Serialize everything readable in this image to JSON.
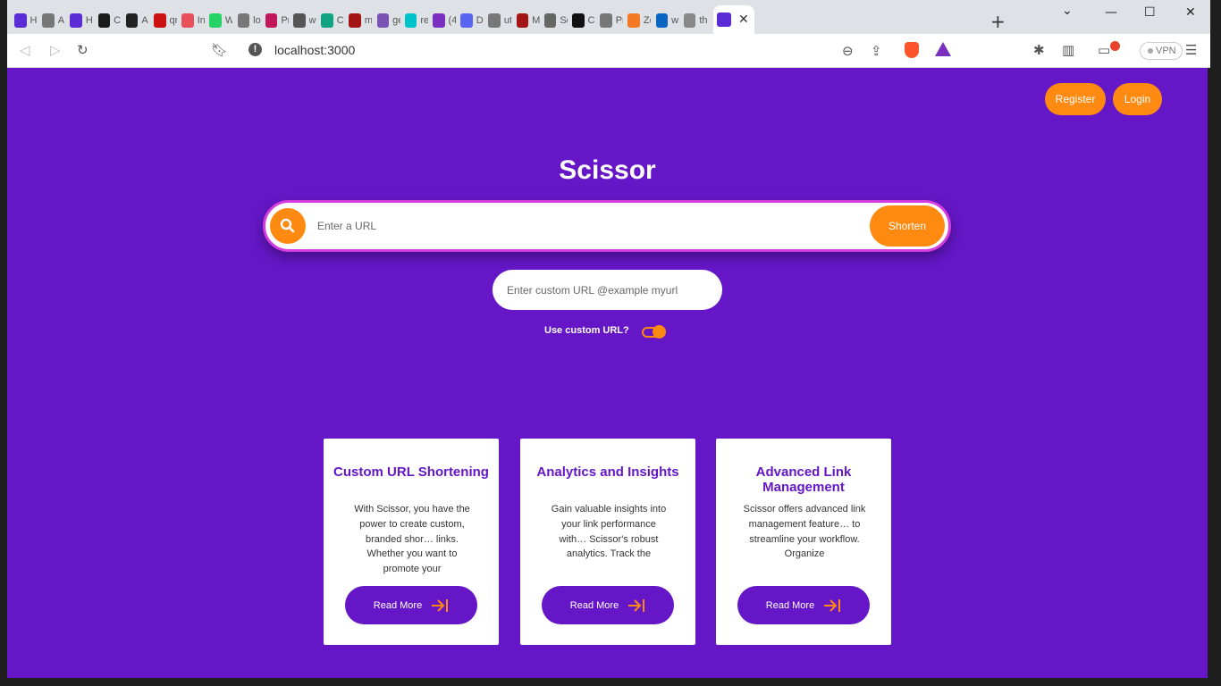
{
  "browser": {
    "tabs": [
      {
        "title": "H",
        "color": "#5b2bd6"
      },
      {
        "title": "A",
        "color": "#777777"
      },
      {
        "title": "H",
        "color": "#5b2bd6"
      },
      {
        "title": "C",
        "color": "#1a1a1a"
      },
      {
        "title": "A",
        "color": "#222222"
      },
      {
        "title": "qr",
        "color": "#cc1111"
      },
      {
        "title": "In",
        "color": "#e8505b"
      },
      {
        "title": "W",
        "color": "#25d366"
      },
      {
        "title": "lo",
        "color": "#777777"
      },
      {
        "title": "Pr",
        "color": "#c2185b"
      },
      {
        "title": "w",
        "color": "#555555"
      },
      {
        "title": "C",
        "color": "#10a37f"
      },
      {
        "title": "m",
        "color": "#a31515"
      },
      {
        "title": "ge",
        "color": "#7952b3"
      },
      {
        "title": "re",
        "color": "#00c2cb"
      },
      {
        "title": "(4",
        "color": "#7b2fbf"
      },
      {
        "title": "D",
        "color": "#5865f2"
      },
      {
        "title": "ut",
        "color": "#777777"
      },
      {
        "title": "M",
        "color": "#a31515"
      },
      {
        "title": "Se",
        "color": "#666666"
      },
      {
        "title": "C",
        "color": "#111111"
      },
      {
        "title": "Pr",
        "color": "#777777"
      },
      {
        "title": "Ze",
        "color": "#f37a22"
      },
      {
        "title": "w",
        "color": "#0a66c2"
      },
      {
        "title": "th",
        "color": "#888888"
      }
    ],
    "active_tab_color": "#5b2bd6",
    "close_glyph": "✕",
    "new_tab_glyph": "+",
    "url": "localhost:3000",
    "vpn_label": "VPN",
    "info_glyph": "!"
  },
  "app": {
    "title": "Scissor",
    "register_label": "Register",
    "login_label": "Login",
    "url_placeholder": "Enter a URL",
    "shorten_label": "Shorten",
    "custom_placeholder": "Enter custom URL @example myurl",
    "custom_toggle_label": "Use custom URL?",
    "custom_toggle_on": true,
    "colors": {
      "brand": "#6517c7",
      "accent": "#ff8a12",
      "search_border": "#d43ce0"
    }
  },
  "cards": [
    {
      "title": "Custom URL Shortening",
      "text": "With Scissor, you have the power to create custom, branded shor… links. Whether you want to promote your",
      "button": "Read More"
    },
    {
      "title": "Analytics and Insights",
      "text": "Gain valuable insights into your link performance with… Scissor's robust analytics. Track the",
      "button": "Read More"
    },
    {
      "title": "Advanced Link Management",
      "text": "Scissor offers advanced link management feature… to streamline your workflow. Organize",
      "button": "Read More"
    }
  ]
}
